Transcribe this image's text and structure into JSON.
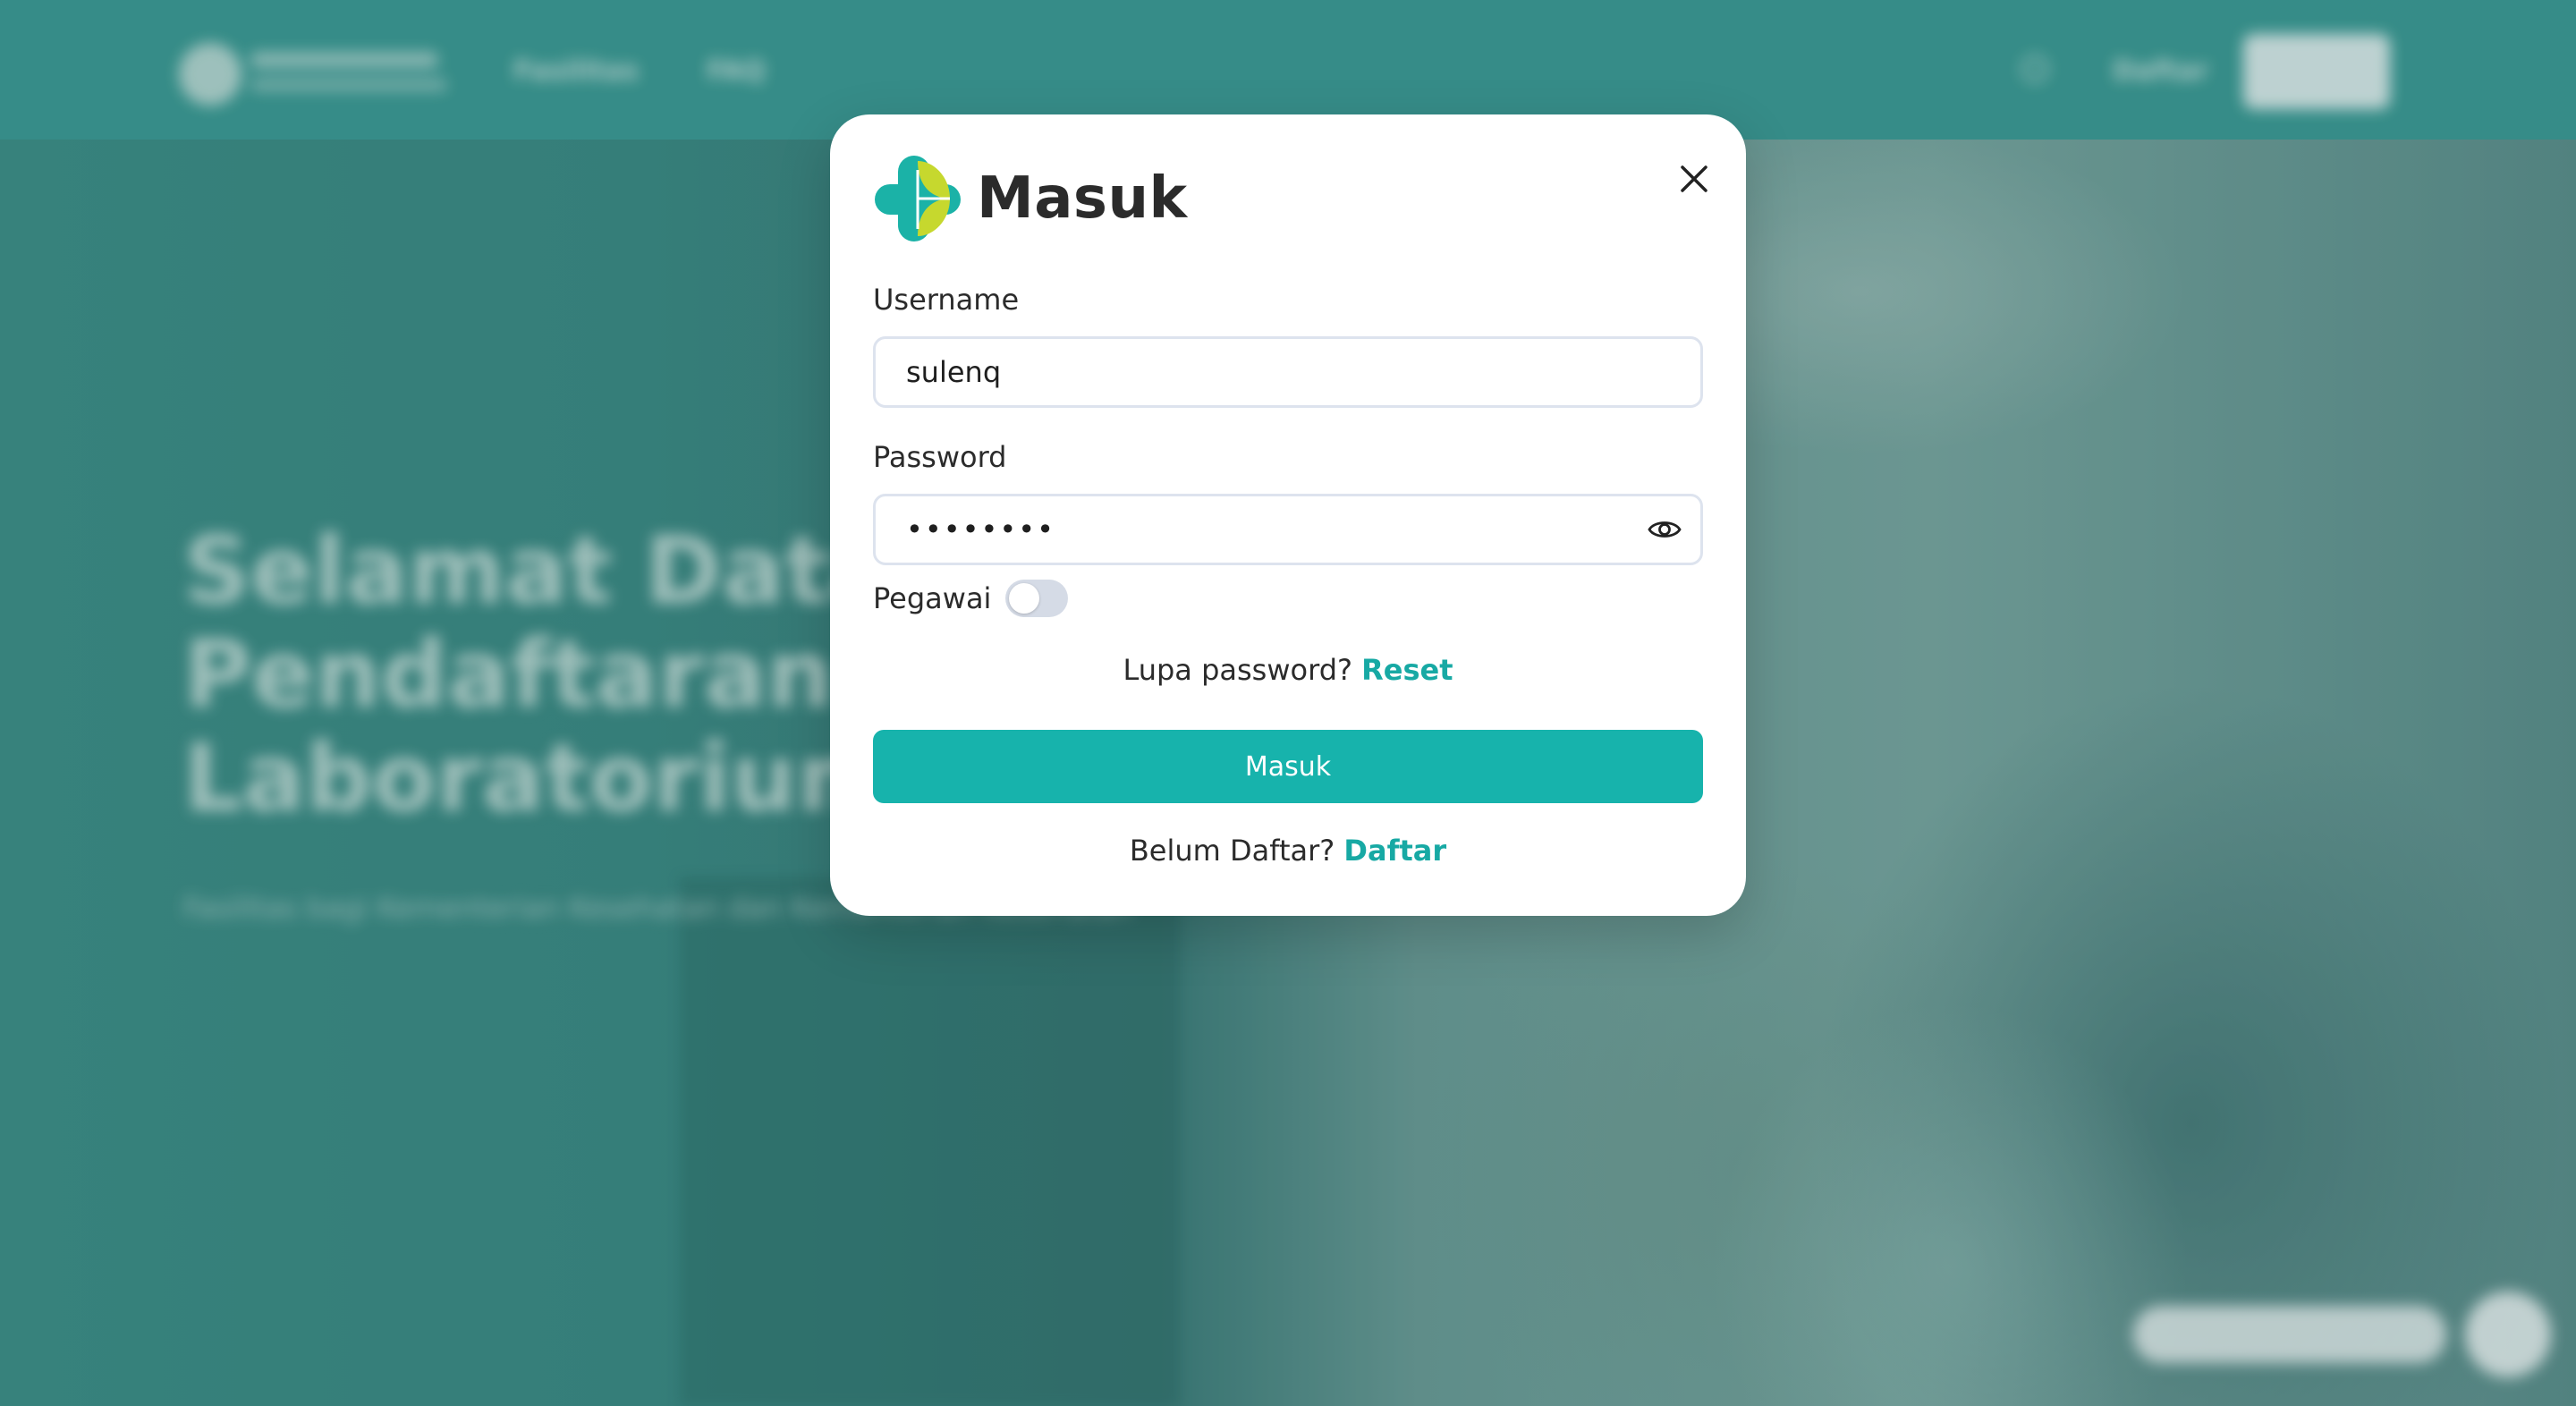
{
  "background": {
    "nav_links": [
      "Fasilitas",
      "FAQ"
    ],
    "nav_login_text": "Daftar",
    "hero_title": "Selamat Datang di\nPendaftaran Pemeriksaan\nLaboratorium",
    "hero_subtitle": "Fasilitas bagi Kementerian Kesehatan dan Kementerian Kesehatan"
  },
  "modal": {
    "title": "Masuk",
    "username_label": "Username",
    "username_value": "sulenq",
    "password_label": "Password",
    "password_value": "••••••••",
    "employee_toggle_label": "Pegawai",
    "employee_toggle_on": false,
    "forgot_text": "Lupa password?",
    "reset_link": "Reset",
    "submit_label": "Masuk",
    "register_text": "Belum Daftar?",
    "register_link": "Daftar"
  },
  "colors": {
    "accent": "#17b3ac",
    "link": "#17a9a4",
    "logo_teal": "#1bb2a7",
    "logo_lime": "#c6d82e"
  }
}
